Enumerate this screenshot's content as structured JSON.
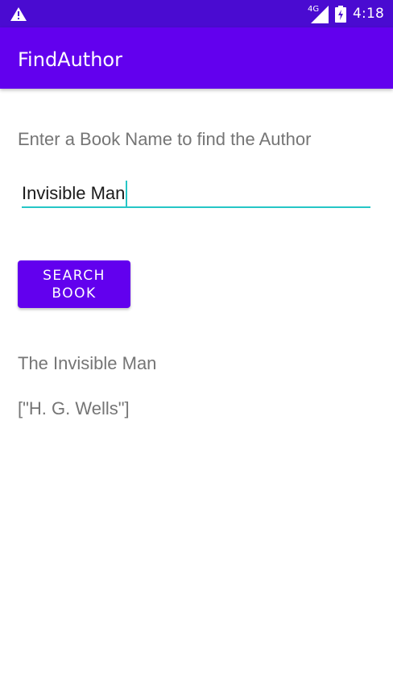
{
  "status_bar": {
    "network_label": "4G",
    "time": "4:18",
    "icons": [
      "warning-icon",
      "signal-icon",
      "battery-charging-icon"
    ],
    "background": "#4a0bd1"
  },
  "app_bar": {
    "title": "FindAuthor",
    "background": "#6200ee"
  },
  "main": {
    "prompt": "Enter a Book Name to find the Author",
    "book_input": {
      "value": "Invisible Man",
      "placeholder": ""
    },
    "search_button_label": "SEARCH BOOK",
    "result_title": "The Invisible Man",
    "result_authors": "[\"H. G. Wells\"]"
  },
  "colors": {
    "accent": "#6200ee",
    "underline": "#26c6c6",
    "secondary_text": "#757575"
  }
}
